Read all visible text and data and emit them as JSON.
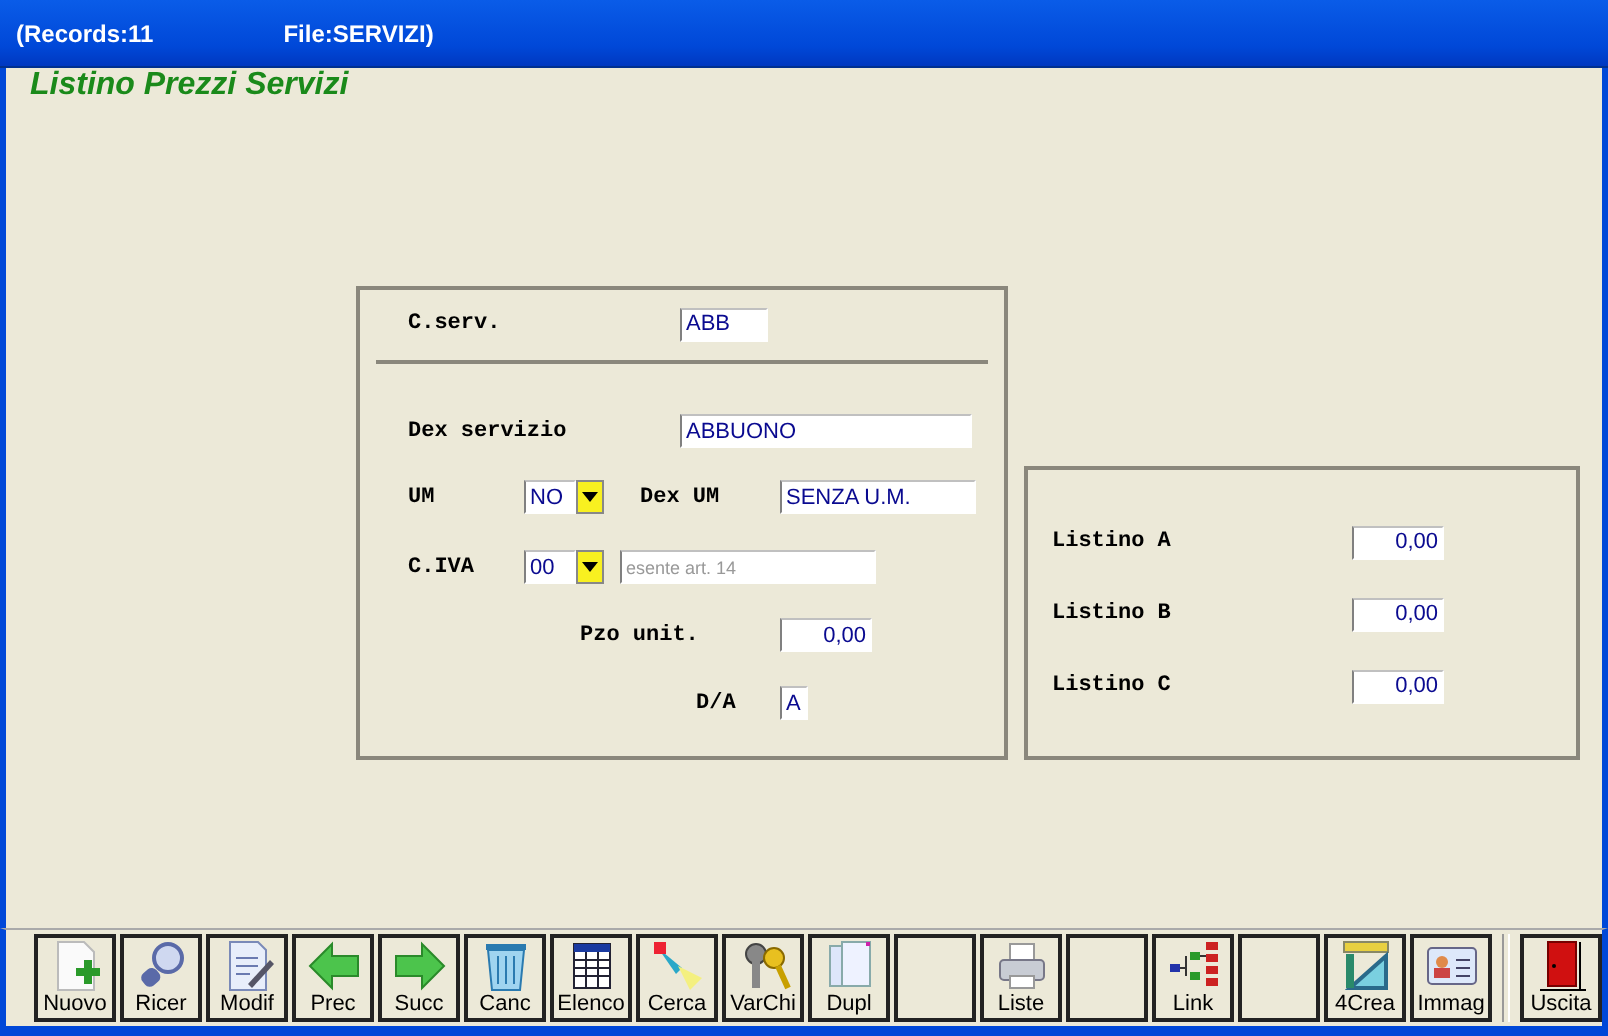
{
  "title_bar": {
    "records": "(Records:11",
    "file": "File:SERVIZI)"
  },
  "form_title": "Listino Prezzi Servizi",
  "main_panel": {
    "code": {
      "label": "C.serv.",
      "value": "ABB"
    },
    "description": {
      "label": "Dex servizio",
      "value": "ABBUONO"
    },
    "unit": {
      "label": "UM",
      "value": "NO",
      "desc_label": "Dex UM",
      "desc_value": "SENZA U.M."
    },
    "vat": {
      "label": "C.IVA",
      "value": "00",
      "desc_value": "esente art. 14",
      "desc_disabled": true
    },
    "unit_price": {
      "label": "Pzo unit.",
      "value": "0,00"
    },
    "da": {
      "label": "D/A",
      "value": "A"
    }
  },
  "price_lists": [
    {
      "label": "Listino A",
      "value": "0,00"
    },
    {
      "label": "Listino B",
      "value": "0,00"
    },
    {
      "label": "Listino C",
      "value": "0,00"
    }
  ],
  "toolbar": [
    {
      "kind": "command",
      "label": "Nuovo"
    },
    {
      "kind": "command",
      "label": "Ricer"
    },
    {
      "kind": "command",
      "label": "Modif"
    },
    {
      "kind": "command",
      "label": "Prec"
    },
    {
      "kind": "command",
      "label": "Succ"
    },
    {
      "kind": "command",
      "label": "Canc"
    },
    {
      "kind": "command",
      "label": "Elenco"
    },
    {
      "kind": "command",
      "label": "Cerca"
    },
    {
      "kind": "command",
      "label": "VarChi"
    },
    {
      "kind": "command",
      "label": "Dupl"
    },
    {
      "kind": "blank"
    },
    {
      "kind": "command",
      "label": "Liste"
    },
    {
      "kind": "blank"
    },
    {
      "kind": "command",
      "label": "Link"
    },
    {
      "kind": "blank"
    },
    {
      "kind": "command",
      "label": "4Crea"
    },
    {
      "kind": "command",
      "label": "Immag"
    },
    {
      "kind": "exit",
      "label": "Uscita"
    }
  ]
}
